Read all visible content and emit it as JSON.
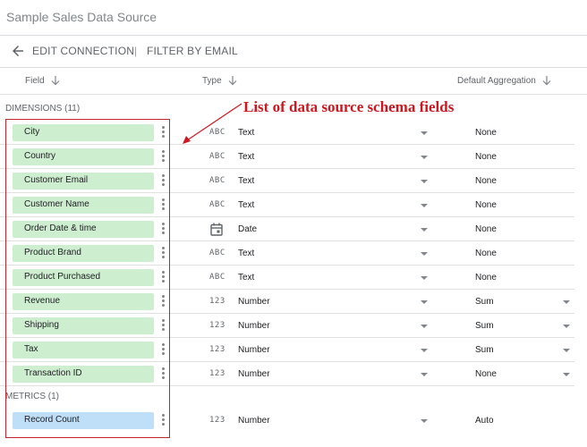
{
  "app_title": "Sample Sales Data Source",
  "toolbar": {
    "edit_connection": "EDIT CONNECTION",
    "separator": "|",
    "filter_by_email": "FILTER BY EMAIL"
  },
  "columns": {
    "field": "Field",
    "type": "Type",
    "default_aggregation": "Default Aggregation"
  },
  "sections": {
    "dimensions": "DIMENSIONS (11)",
    "metrics": "METRICS (1)"
  },
  "dimensions": [
    {
      "name": "City",
      "type_icon": "ABC",
      "type": "Text",
      "aggregation": "None",
      "agg_dropdown": false
    },
    {
      "name": "Country",
      "type_icon": "ABC",
      "type": "Text",
      "aggregation": "None",
      "agg_dropdown": false
    },
    {
      "name": "Customer Email",
      "type_icon": "ABC",
      "type": "Text",
      "aggregation": "None",
      "agg_dropdown": false
    },
    {
      "name": "Customer Name",
      "type_icon": "ABC",
      "type": "Text",
      "aggregation": "None",
      "agg_dropdown": false
    },
    {
      "name": "Order Date & time",
      "type_icon": "calendar-icon",
      "type": "Date",
      "aggregation": "None",
      "agg_dropdown": false
    },
    {
      "name": "Product Brand",
      "type_icon": "ABC",
      "type": "Text",
      "aggregation": "None",
      "agg_dropdown": false
    },
    {
      "name": "Product Purchased",
      "type_icon": "ABC",
      "type": "Text",
      "aggregation": "None",
      "agg_dropdown": false
    },
    {
      "name": "Revenue",
      "type_icon": "123",
      "type": "Number",
      "aggregation": "Sum",
      "agg_dropdown": true
    },
    {
      "name": "Shipping",
      "type_icon": "123",
      "type": "Number",
      "aggregation": "Sum",
      "agg_dropdown": true
    },
    {
      "name": "Tax",
      "type_icon": "123",
      "type": "Number",
      "aggregation": "Sum",
      "agg_dropdown": true
    },
    {
      "name": "Transaction ID",
      "type_icon": "123",
      "type": "Number",
      "aggregation": "None",
      "agg_dropdown": true
    }
  ],
  "metrics": [
    {
      "name": "Record Count",
      "type_icon": "123",
      "type": "Number",
      "aggregation": "Auto",
      "agg_dropdown": false
    }
  ],
  "annotation": {
    "text": "List of data source schema fields",
    "color": "#d0161e"
  },
  "colors": {
    "dimension_chip": "#cdeecf",
    "metric_chip": "#bfdef7"
  }
}
